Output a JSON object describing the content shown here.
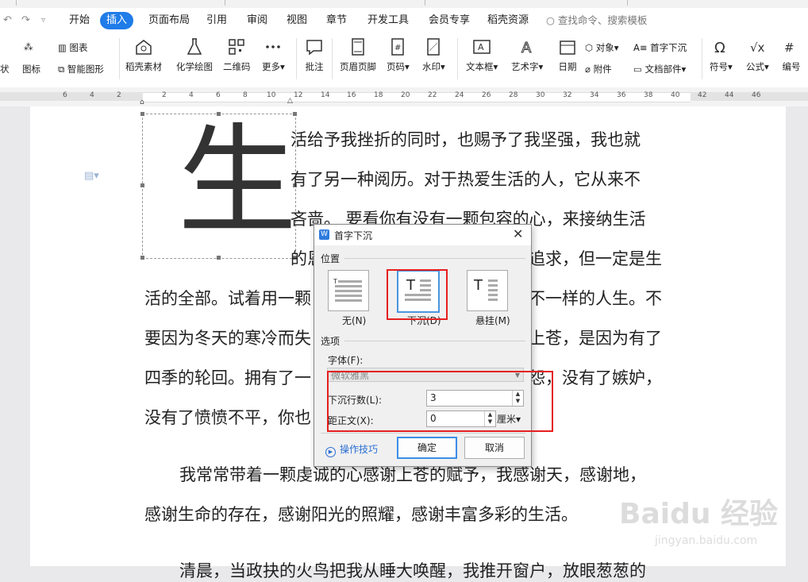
{
  "menubar": {
    "items": [
      "开始",
      "插入",
      "页面布局",
      "引用",
      "审阅",
      "视图",
      "章节",
      "开发工具",
      "会员专享",
      "稻壳资源"
    ],
    "active": "插入",
    "search_placeholder": "查找命令、搜索模板"
  },
  "ribbon": {
    "chart_label": "图表",
    "icon_lib_label": "图标",
    "smart_graphic_label": "智能图形",
    "shell_material_label": "稻壳素材",
    "chem_draw_label": "化学绘图",
    "qrcode_label": "二维码",
    "more_label": "更多",
    "comment_label": "批注",
    "header_footer_label": "页眉页脚",
    "page_num_label": "页码",
    "watermark_label": "水印",
    "textbox_label": "文本框",
    "wordart_label": "艺术字",
    "date_label": "日期",
    "object_label": "对象",
    "attachment_label": "附件",
    "dropcap_label": "首字下沉",
    "doc_parts_label": "文档部件",
    "symbol_label": "符号",
    "formula_label": "公式",
    "numbering_label": "编号",
    "left_cut_label": "状"
  },
  "ruler": {
    "ticks": [
      "6",
      "4",
      "2",
      "2",
      "4",
      "6",
      "8",
      "10",
      "12",
      "14",
      "16",
      "18",
      "20",
      "22",
      "24",
      "26",
      "28",
      "30",
      "32",
      "34",
      "36",
      "38",
      "40",
      "42",
      "44",
      "46"
    ]
  },
  "document": {
    "dropcap_char": "生",
    "lines": [
      "活给予我挫折的同时，也赐予了我坚强，我也就",
      "有了另一种阅历。对于热爱生活的人，它从来不",
      "吝啬。 要看你有没有一颗包容的心，来接纳生活",
      "的恩",
      "追求，但一定是生",
      "活的全部。试着用一颗",
      "不一样的人生。不",
      "要因为冬天的寒冷而失",
      "上苍，是因为有了",
      "四季的轮回。拥有了一",
      "怨，没有了嫉妒，",
      "没有了愤愤不平，你也",
      "我常常带着一颗虔诚的心感谢上苍的赋予，我感谢天，感谢地，",
      "感谢生命的存在，感谢阳光的照耀，感谢丰富多彩的生活。",
      "清晨，当政抉的火鸟把我从睡大唤醒，我推开窗户，放眼葱葱的"
    ]
  },
  "dialog": {
    "title": "首字下沉",
    "position_group": "位置",
    "options_group": "选项",
    "opt_none": "无(N)",
    "opt_drop": "下沉(D)",
    "opt_margin": "悬挂(M)",
    "font_label": "字体(F):",
    "font_value": "微软雅黑",
    "lines_label": "下沉行数(L):",
    "lines_value": "3",
    "distance_label": "距正文(X):",
    "distance_value": "0",
    "unit": "厘米",
    "tips": "操作技巧",
    "ok": "确定",
    "cancel": "取消",
    "selected_option": "下沉(D)"
  },
  "watermark": {
    "brand": "Baidu 经验",
    "url": "jingyan.baidu.com"
  },
  "colors": {
    "accent": "#1f7ce8",
    "highlight_box": "#e51f1f"
  }
}
